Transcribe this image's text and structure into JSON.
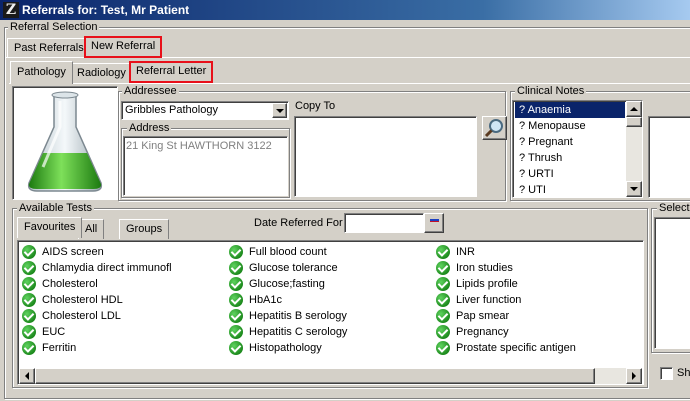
{
  "window": {
    "title": "Referrals for: Test, Mr Patient",
    "app_icon": "Z"
  },
  "referral_selection": {
    "legend": "Referral Selection",
    "tabs": [
      {
        "label": "Past Referrals"
      },
      {
        "label": "New Referral"
      }
    ]
  },
  "sub_tabs": [
    {
      "label": "Pathology"
    },
    {
      "label": "Radiology"
    },
    {
      "label": "Referral Letter"
    }
  ],
  "addressee": {
    "legend": "Addressee",
    "selected": "Gribbles Pathology",
    "address_legend": "Address",
    "address": "21 King St HAWTHORN  3122"
  },
  "copy_to": {
    "label": "Copy To"
  },
  "clinical_notes": {
    "legend": "Clinical Notes",
    "items": [
      "? Anaemia",
      "? Menopause",
      "? Pregnant",
      "? Thrush",
      "? URTI",
      "? UTI"
    ],
    "selected_index": 0
  },
  "available_tests": {
    "legend": "Available Tests",
    "tabs": [
      "Favourites",
      "All",
      "Groups"
    ],
    "date_label": "Date Referred For",
    "date_value": "",
    "columns": [
      [
        "AIDS screen",
        "Chlamydia direct immunofl",
        "Cholesterol",
        "Cholesterol HDL",
        "Cholesterol LDL",
        "EUC",
        "Ferritin"
      ],
      [
        "Full blood count",
        "Glucose tolerance",
        "Glucose;fasting",
        "HbA1c",
        "Hepatitis B serology",
        "Hepatitis C serology",
        "Histopathology"
      ],
      [
        "INR",
        "Iron studies",
        "Lipids profile",
        "Liver function",
        "Pap smear",
        "Pregnancy",
        "Prostate specific antigen"
      ]
    ]
  },
  "right_panel": {
    "selected_legend": "Select",
    "checkbox_label": "Sh"
  },
  "colors": {
    "highlight_red": "#e8101a",
    "selection_blue": "#0a246a"
  }
}
